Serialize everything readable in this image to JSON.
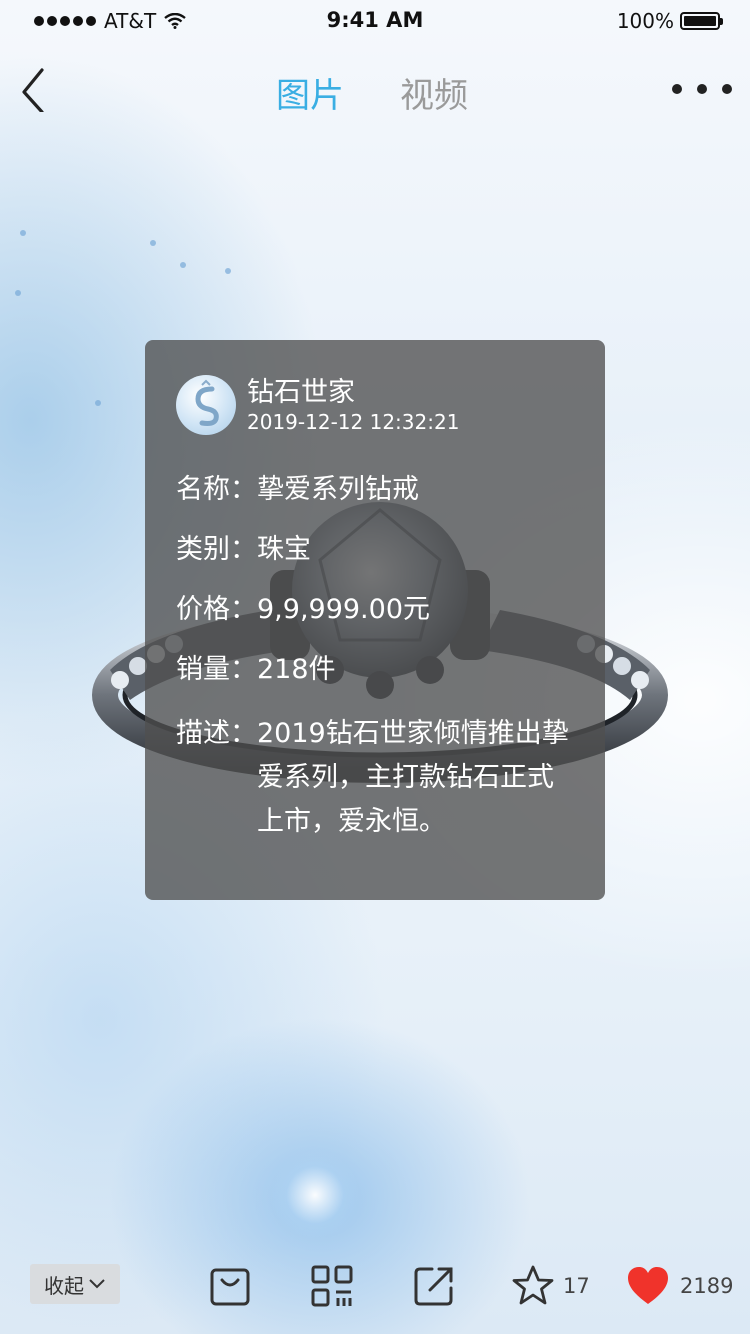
{
  "status_bar": {
    "carrier": "AT&T",
    "time": "9:41 AM",
    "battery": "100%"
  },
  "nav": {
    "tabs": [
      {
        "label": "图片",
        "active": true
      },
      {
        "label": "视频",
        "active": false
      }
    ]
  },
  "shop": {
    "name": "钻石世家",
    "datetime": "2019-12-12  12:32:21"
  },
  "product": {
    "name_label": "名称：",
    "name": "挚爱系列钻戒",
    "category_label": "类别：",
    "category": "珠宝",
    "price_label": "价格：",
    "price": "9,9,999.00元",
    "sales_label": "销量：",
    "sales": "218件",
    "desc_label": "描述：",
    "desc": "2019钻石世家倾情推出挚爱系列，主打款钻石正式上市，爱永恒。"
  },
  "bottom_bar": {
    "collapse_label": "收起",
    "favorite_count": "17",
    "like_count": "2189"
  },
  "colors": {
    "accent": "#3aaee3",
    "like": "#f0332b",
    "panel": "#505050"
  }
}
